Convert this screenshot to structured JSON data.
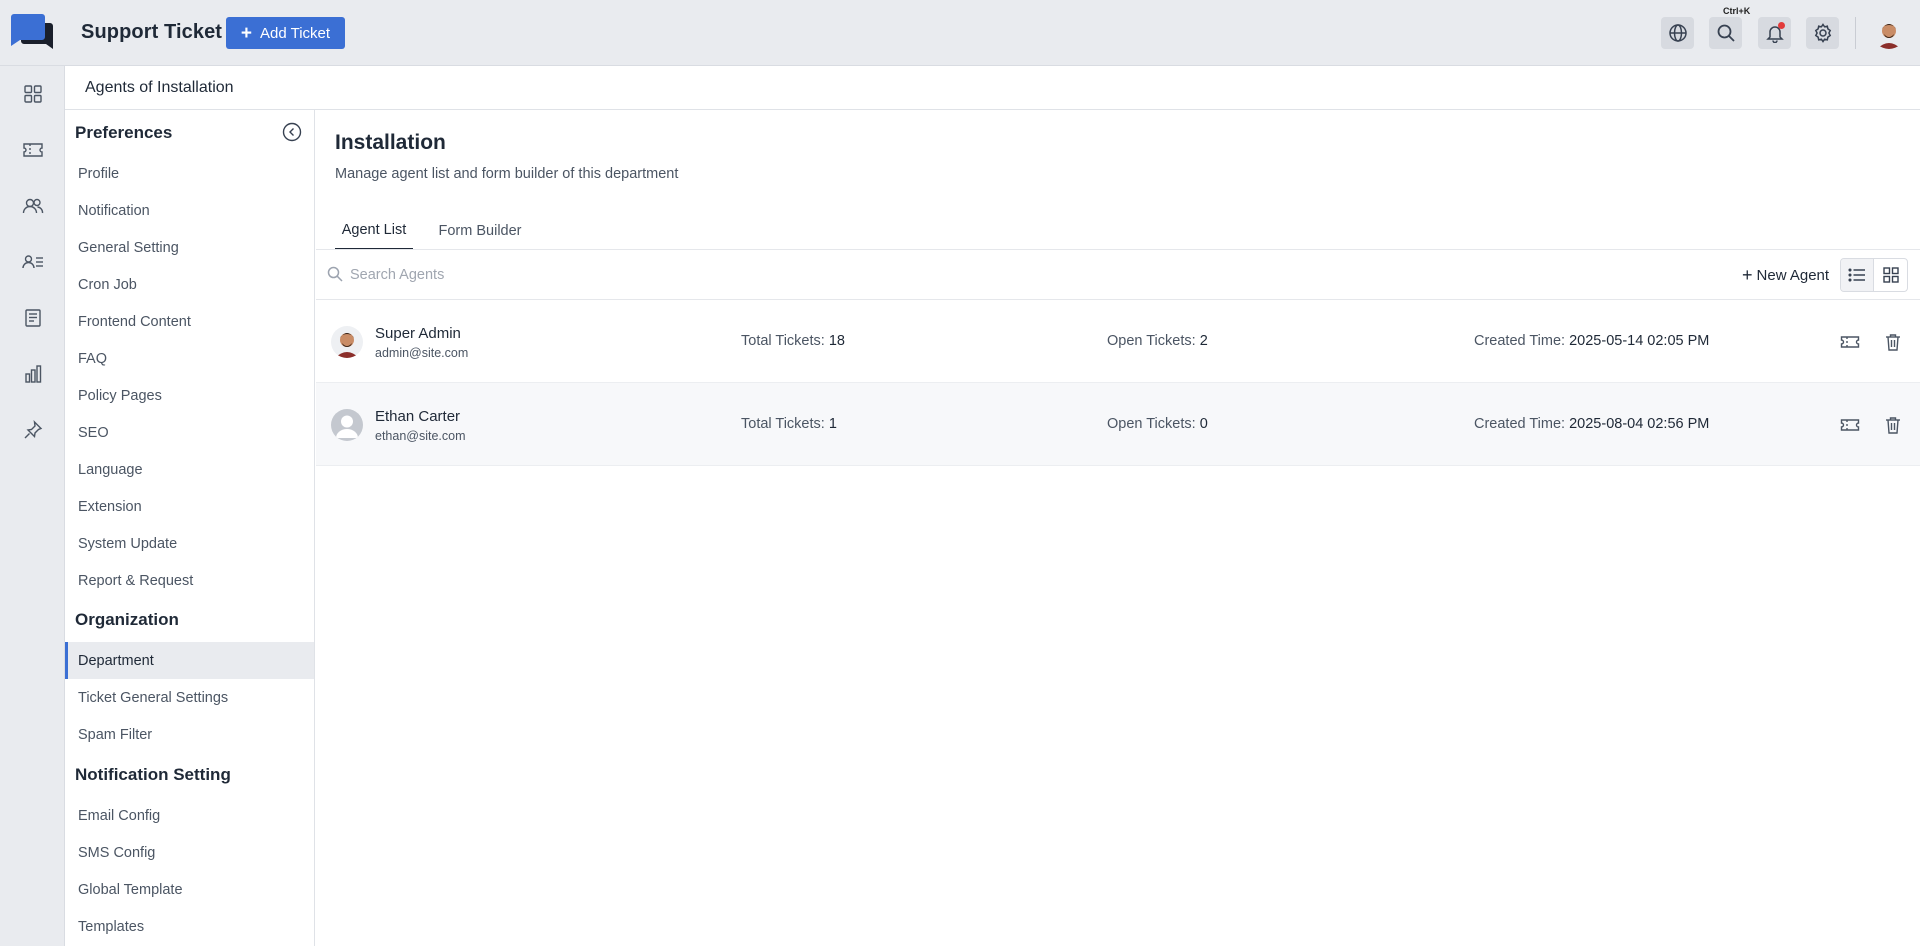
{
  "app": {
    "title": "Support Ticket",
    "add_ticket_label": "Add Ticket",
    "search_shortcut": "Ctrl+K"
  },
  "breadcrumb": "Agents of Installation",
  "preferences": {
    "title": "Preferences",
    "items": [
      "Profile",
      "Notification",
      "General Setting",
      "Cron Job",
      "Frontend Content",
      "FAQ",
      "Policy Pages",
      "SEO",
      "Language",
      "Extension",
      "System Update",
      "Report & Request"
    ]
  },
  "organization": {
    "title": "Organization",
    "items": [
      "Department",
      "Ticket General Settings",
      "Spam Filter"
    ],
    "active": "Department"
  },
  "notification_setting": {
    "title": "Notification Setting",
    "items": [
      "Email Config",
      "SMS Config",
      "Global Template",
      "Templates"
    ]
  },
  "department": {
    "title": "Installation",
    "subtitle": "Manage agent list and form builder of this department",
    "tabs": [
      "Agent List",
      "Form Builder"
    ],
    "active_tab": "Agent List"
  },
  "search": {
    "placeholder": "Search Agents"
  },
  "new_agent_label": "New Agent",
  "stat_labels": {
    "total": "Total Tickets:",
    "open": "Open Tickets:",
    "created": "Created Time:"
  },
  "agents": [
    {
      "name": "Super Admin",
      "email": "admin@site.com",
      "total_tickets": "18",
      "open_tickets": "2",
      "created_time": "2025-05-14 02:05 PM"
    },
    {
      "name": "Ethan Carter",
      "email": "ethan@site.com",
      "total_tickets": "1",
      "open_tickets": "0",
      "created_time": "2025-08-04 02:56 PM"
    }
  ],
  "colors": {
    "accent": "#3b6fd4",
    "notification_dot": "#e23b3b",
    "rail_bg": "#e9ebef"
  }
}
